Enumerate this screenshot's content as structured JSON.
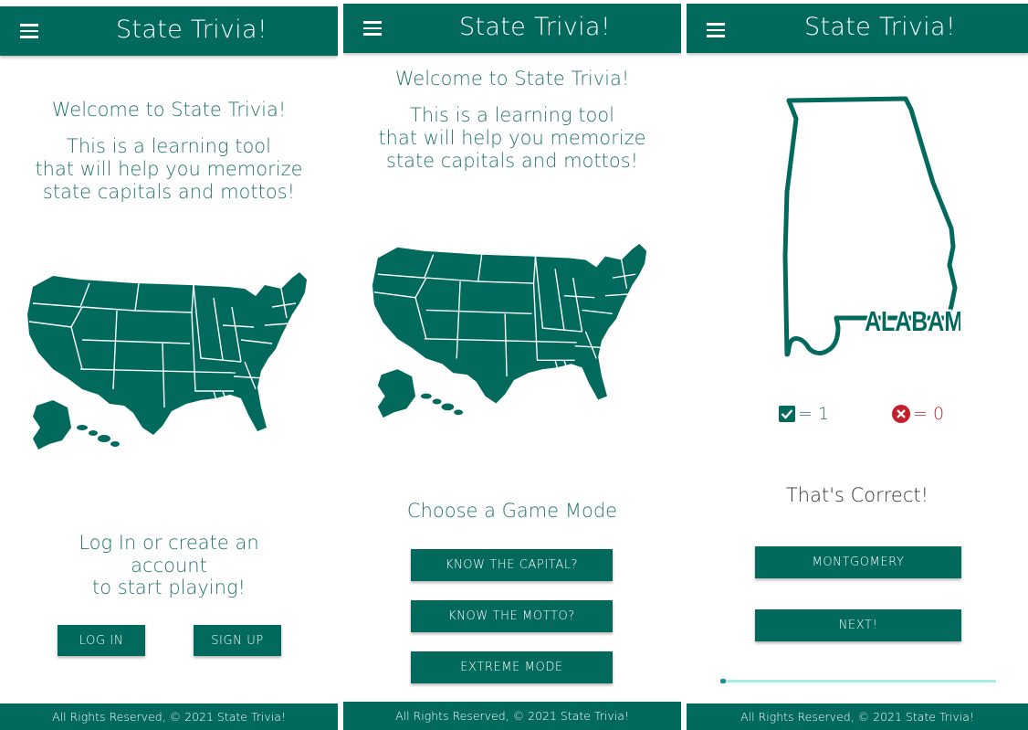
{
  "app_title": "State Trivia!",
  "footer_text": "All Rights Reserved, © 2021 State Trivia!",
  "colors": {
    "primary": "#02695d",
    "text_teal": "#27756c",
    "incorrect_red": "#c81e2a",
    "progress_track": "#a7ece6"
  },
  "screen1": {
    "welcome": "Welcome to State Trivia!",
    "intro_lines": [
      "This is a learning tool",
      "that will help you memorize",
      "state capitals and mottos!"
    ],
    "login_prompt_lines": [
      "Log In or create an",
      "account",
      "to start playing!"
    ],
    "login_button": "LOG IN",
    "signup_button": "SIGN UP"
  },
  "screen2": {
    "welcome": "Welcome to State Trivia!",
    "intro_lines": [
      "This is a learning tool",
      "that will help you memorize",
      "state capitals and mottos!"
    ],
    "choose_mode": "Choose a Game Mode",
    "mode_buttons": [
      "KNOW THE CAPITAL?",
      "KNOW THE MOTTO?",
      "EXTREME MODE"
    ]
  },
  "screen3": {
    "state_label": "ALABAMA",
    "correct_score": "= 1",
    "incorrect_score": "= 0",
    "result_message": "That's Correct!",
    "answer_button": "MONTGOMERY",
    "next_button": "NEXT!",
    "progress": 0.02
  },
  "icons": {
    "menu": "hamburger-menu-icon",
    "correct": "checkbox-checked-icon",
    "incorrect": "cancel-circle-icon"
  }
}
